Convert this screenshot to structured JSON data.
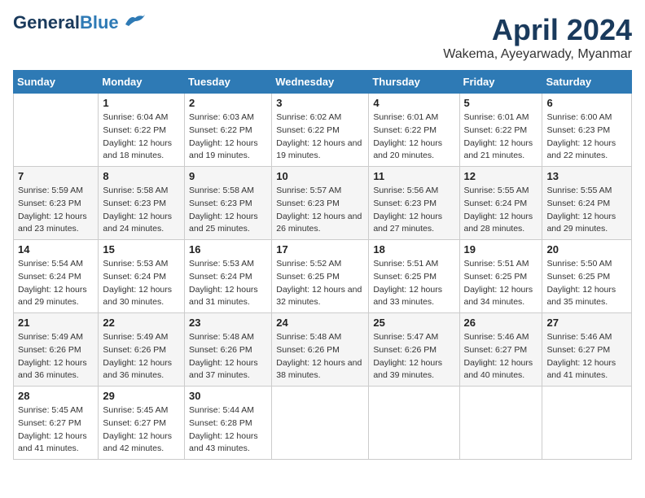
{
  "header": {
    "logo_general": "General",
    "logo_blue": "Blue",
    "month_title": "April 2024",
    "location": "Wakema, Ayeyarwady, Myanmar"
  },
  "weekdays": [
    "Sunday",
    "Monday",
    "Tuesday",
    "Wednesday",
    "Thursday",
    "Friday",
    "Saturday"
  ],
  "weeks": [
    [
      {
        "day": "",
        "sunrise": "",
        "sunset": "",
        "daylight": ""
      },
      {
        "day": "1",
        "sunrise": "Sunrise: 6:04 AM",
        "sunset": "Sunset: 6:22 PM",
        "daylight": "Daylight: 12 hours and 18 minutes."
      },
      {
        "day": "2",
        "sunrise": "Sunrise: 6:03 AM",
        "sunset": "Sunset: 6:22 PM",
        "daylight": "Daylight: 12 hours and 19 minutes."
      },
      {
        "day": "3",
        "sunrise": "Sunrise: 6:02 AM",
        "sunset": "Sunset: 6:22 PM",
        "daylight": "Daylight: 12 hours and 19 minutes."
      },
      {
        "day": "4",
        "sunrise": "Sunrise: 6:01 AM",
        "sunset": "Sunset: 6:22 PM",
        "daylight": "Daylight: 12 hours and 20 minutes."
      },
      {
        "day": "5",
        "sunrise": "Sunrise: 6:01 AM",
        "sunset": "Sunset: 6:22 PM",
        "daylight": "Daylight: 12 hours and 21 minutes."
      },
      {
        "day": "6",
        "sunrise": "Sunrise: 6:00 AM",
        "sunset": "Sunset: 6:23 PM",
        "daylight": "Daylight: 12 hours and 22 minutes."
      }
    ],
    [
      {
        "day": "7",
        "sunrise": "Sunrise: 5:59 AM",
        "sunset": "Sunset: 6:23 PM",
        "daylight": "Daylight: 12 hours and 23 minutes."
      },
      {
        "day": "8",
        "sunrise": "Sunrise: 5:58 AM",
        "sunset": "Sunset: 6:23 PM",
        "daylight": "Daylight: 12 hours and 24 minutes."
      },
      {
        "day": "9",
        "sunrise": "Sunrise: 5:58 AM",
        "sunset": "Sunset: 6:23 PM",
        "daylight": "Daylight: 12 hours and 25 minutes."
      },
      {
        "day": "10",
        "sunrise": "Sunrise: 5:57 AM",
        "sunset": "Sunset: 6:23 PM",
        "daylight": "Daylight: 12 hours and 26 minutes."
      },
      {
        "day": "11",
        "sunrise": "Sunrise: 5:56 AM",
        "sunset": "Sunset: 6:23 PM",
        "daylight": "Daylight: 12 hours and 27 minutes."
      },
      {
        "day": "12",
        "sunrise": "Sunrise: 5:55 AM",
        "sunset": "Sunset: 6:24 PM",
        "daylight": "Daylight: 12 hours and 28 minutes."
      },
      {
        "day": "13",
        "sunrise": "Sunrise: 5:55 AM",
        "sunset": "Sunset: 6:24 PM",
        "daylight": "Daylight: 12 hours and 29 minutes."
      }
    ],
    [
      {
        "day": "14",
        "sunrise": "Sunrise: 5:54 AM",
        "sunset": "Sunset: 6:24 PM",
        "daylight": "Daylight: 12 hours and 29 minutes."
      },
      {
        "day": "15",
        "sunrise": "Sunrise: 5:53 AM",
        "sunset": "Sunset: 6:24 PM",
        "daylight": "Daylight: 12 hours and 30 minutes."
      },
      {
        "day": "16",
        "sunrise": "Sunrise: 5:53 AM",
        "sunset": "Sunset: 6:24 PM",
        "daylight": "Daylight: 12 hours and 31 minutes."
      },
      {
        "day": "17",
        "sunrise": "Sunrise: 5:52 AM",
        "sunset": "Sunset: 6:25 PM",
        "daylight": "Daylight: 12 hours and 32 minutes."
      },
      {
        "day": "18",
        "sunrise": "Sunrise: 5:51 AM",
        "sunset": "Sunset: 6:25 PM",
        "daylight": "Daylight: 12 hours and 33 minutes."
      },
      {
        "day": "19",
        "sunrise": "Sunrise: 5:51 AM",
        "sunset": "Sunset: 6:25 PM",
        "daylight": "Daylight: 12 hours and 34 minutes."
      },
      {
        "day": "20",
        "sunrise": "Sunrise: 5:50 AM",
        "sunset": "Sunset: 6:25 PM",
        "daylight": "Daylight: 12 hours and 35 minutes."
      }
    ],
    [
      {
        "day": "21",
        "sunrise": "Sunrise: 5:49 AM",
        "sunset": "Sunset: 6:26 PM",
        "daylight": "Daylight: 12 hours and 36 minutes."
      },
      {
        "day": "22",
        "sunrise": "Sunrise: 5:49 AM",
        "sunset": "Sunset: 6:26 PM",
        "daylight": "Daylight: 12 hours and 36 minutes."
      },
      {
        "day": "23",
        "sunrise": "Sunrise: 5:48 AM",
        "sunset": "Sunset: 6:26 PM",
        "daylight": "Daylight: 12 hours and 37 minutes."
      },
      {
        "day": "24",
        "sunrise": "Sunrise: 5:48 AM",
        "sunset": "Sunset: 6:26 PM",
        "daylight": "Daylight: 12 hours and 38 minutes."
      },
      {
        "day": "25",
        "sunrise": "Sunrise: 5:47 AM",
        "sunset": "Sunset: 6:26 PM",
        "daylight": "Daylight: 12 hours and 39 minutes."
      },
      {
        "day": "26",
        "sunrise": "Sunrise: 5:46 AM",
        "sunset": "Sunset: 6:27 PM",
        "daylight": "Daylight: 12 hours and 40 minutes."
      },
      {
        "day": "27",
        "sunrise": "Sunrise: 5:46 AM",
        "sunset": "Sunset: 6:27 PM",
        "daylight": "Daylight: 12 hours and 41 minutes."
      }
    ],
    [
      {
        "day": "28",
        "sunrise": "Sunrise: 5:45 AM",
        "sunset": "Sunset: 6:27 PM",
        "daylight": "Daylight: 12 hours and 41 minutes."
      },
      {
        "day": "29",
        "sunrise": "Sunrise: 5:45 AM",
        "sunset": "Sunset: 6:27 PM",
        "daylight": "Daylight: 12 hours and 42 minutes."
      },
      {
        "day": "30",
        "sunrise": "Sunrise: 5:44 AM",
        "sunset": "Sunset: 6:28 PM",
        "daylight": "Daylight: 12 hours and 43 minutes."
      },
      {
        "day": "",
        "sunrise": "",
        "sunset": "",
        "daylight": ""
      },
      {
        "day": "",
        "sunrise": "",
        "sunset": "",
        "daylight": ""
      },
      {
        "day": "",
        "sunrise": "",
        "sunset": "",
        "daylight": ""
      },
      {
        "day": "",
        "sunrise": "",
        "sunset": "",
        "daylight": ""
      }
    ]
  ]
}
